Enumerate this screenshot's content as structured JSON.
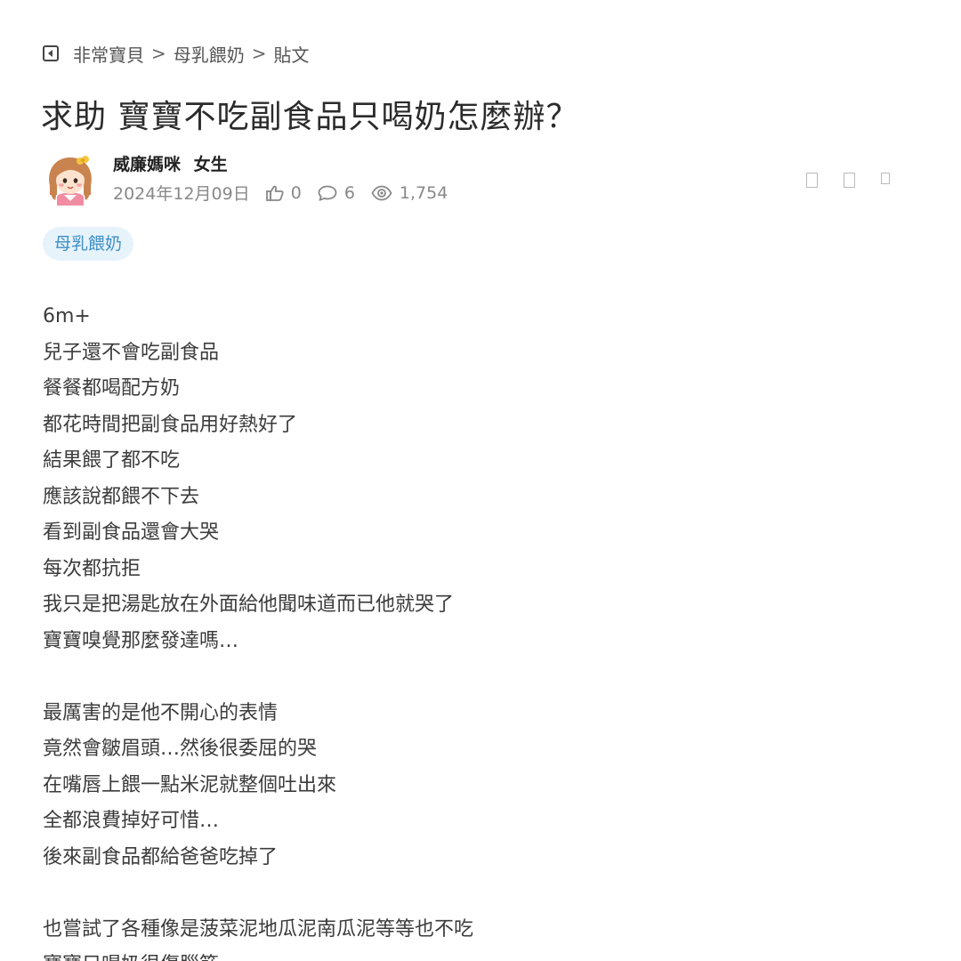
{
  "breadcrumb": {
    "items": [
      "非常寶貝",
      "母乳餵奶",
      "貼文"
    ],
    "separator": ">"
  },
  "post": {
    "title": "求助 寶寶不吃副食品只喝奶怎麼辦？",
    "author": {
      "name": "威廉媽咪",
      "gender": "女生",
      "avatar": "cartoon-girl-avatar"
    },
    "date": "2024年12月09日",
    "likes": "0",
    "comments": "6",
    "views": "1,754",
    "tag": "母乳餵奶",
    "paragraphs": [
      [
        "6m+",
        "兒子還不會吃副食品",
        "餐餐都喝配方奶",
        "都花時間把副食品用好熱好了",
        "結果餵了都不吃",
        "應該說都餵不下去",
        "看到副食品還會大哭",
        "每次都抗拒",
        "我只是把湯匙放在外面給他聞味道而已他就哭了",
        "寶寶嗅覺那麼發達嗎…"
      ],
      [
        "最厲害的是他不開心的表情",
        "竟然會皺眉頭…然後很委屈的哭",
        "在嘴唇上餵一點米泥就整個吐出來",
        "全都浪費掉好可惜…",
        "後來副食品都給爸爸吃掉了"
      ],
      [
        "也嘗試了各種像是菠菜泥地瓜泥南瓜泥等等也不吃",
        "寶寶只喝奶很傷腦筋"
      ]
    ]
  },
  "icons": {
    "back": "back-arrow-icon",
    "like": "thumbs-up-icon",
    "comment": "comment-bubble-icon",
    "view": "eye-icon"
  },
  "colors": {
    "tag_background": "#e7f3fb",
    "tag_text": "#3e8fc6",
    "meta_text": "#888888"
  }
}
